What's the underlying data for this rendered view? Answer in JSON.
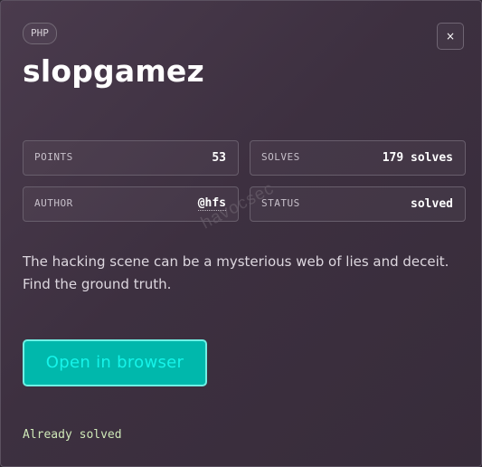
{
  "challenge": {
    "language": "PHP",
    "title": "slopgamez",
    "close_label": "×",
    "description": "The hacking scene can be a mysterious web of lies and deceit. Find the ground truth."
  },
  "stats": {
    "points": {
      "label": "POINTS",
      "value": "53"
    },
    "solves": {
      "label": "SOLVES",
      "value": "179 solves"
    },
    "author": {
      "label": "AUTHOR",
      "value": "@hfs"
    },
    "status": {
      "label": "STATUS",
      "value": "solved"
    }
  },
  "actions": {
    "open_label": "Open in browser"
  },
  "footer": {
    "solved_note": "Already solved"
  },
  "watermark": "havocsec",
  "colors": {
    "accent": "#00b8ac",
    "accent_text": "#16f4ea",
    "solved_note": "#cfe9b8"
  }
}
